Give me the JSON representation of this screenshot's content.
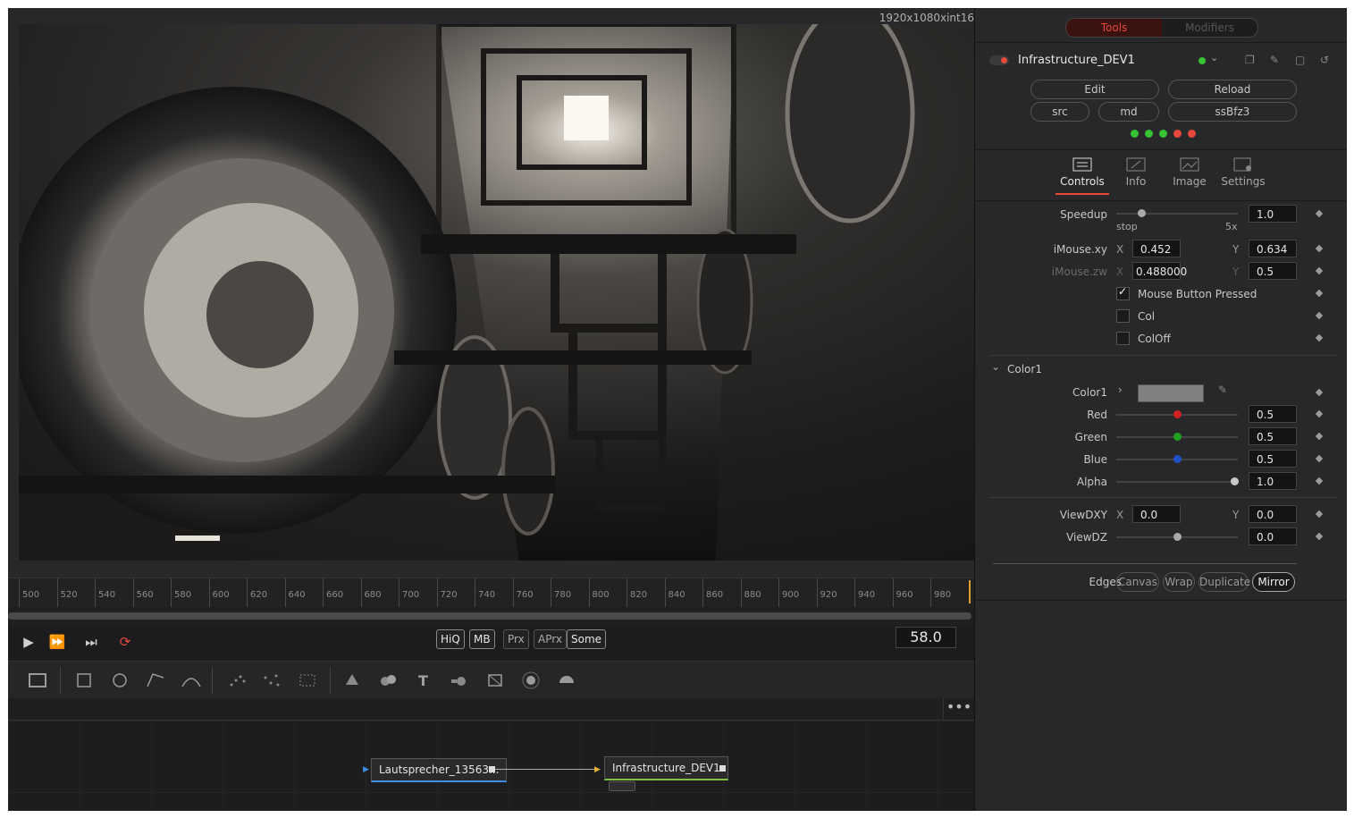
{
  "viewer": {
    "resolution": "1920x1080xint16"
  },
  "ruler": {
    "ticks": [
      "500",
      "520",
      "540",
      "560",
      "580",
      "600",
      "620",
      "640",
      "660",
      "680",
      "700",
      "720",
      "740",
      "760",
      "780",
      "800",
      "820",
      "840",
      "860",
      "880",
      "900",
      "920",
      "940",
      "960",
      "980"
    ]
  },
  "transport": {
    "modes": [
      "HiQ",
      "MB",
      "Prx",
      "APrx",
      "Some"
    ],
    "frame": "58.0"
  },
  "toolbar": {
    "icons": [
      "background-icon",
      "rectangle-icon",
      "ellipse-icon",
      "polygon-icon",
      "bspline-icon",
      "particle-emitter-icon",
      "particle-render-icon",
      "particle-grid-icon",
      "shape3d-icon",
      "merge3d-icon",
      "text3d-icon",
      "camera3d-icon",
      "renderer3d-icon",
      "light-icon",
      "spotlight-icon"
    ]
  },
  "nodes": {
    "source": "Lautsprecher_13563...",
    "target": "Infrastructure_DEV1"
  },
  "inspector": {
    "tabs": {
      "tools": "Tools",
      "modifiers": "Modifiers"
    },
    "node_name": "Infrastructure_DEV1",
    "buttons": {
      "edit": "Edit",
      "reload": "Reload",
      "src": "src",
      "md": "md",
      "shader": "ssBfz3"
    },
    "status_colors": [
      "#35c235",
      "#35c235",
      "#35c235",
      "#e8483a",
      "#e8483a"
    ],
    "panel_tabs": [
      "Controls",
      "Info",
      "Image",
      "Settings"
    ],
    "speedup": {
      "label": "Speedup",
      "value": "1.0",
      "min_label": "stop",
      "max_label": "5x",
      "fraction": 0.2
    },
    "imouse_xy": {
      "label": "iMouse.xy",
      "x_label": "X",
      "x": "0.452",
      "y_label": "Y",
      "y": "0.634"
    },
    "imouse_zw": {
      "label": "iMouse.zw",
      "x_label": "X",
      "x": "0.488000",
      "y_label": "Y",
      "y": "0.5"
    },
    "checks": [
      {
        "label": "Mouse Button Pressed",
        "checked": true
      },
      {
        "label": "Col",
        "checked": false
      },
      {
        "label": "ColOff",
        "checked": false
      }
    ],
    "color_group": "Color1",
    "color_label": "Color1",
    "swatch": "#808080",
    "channels": [
      {
        "label": "Red",
        "value": "0.5",
        "color": "#d02020",
        "fraction": 0.5
      },
      {
        "label": "Green",
        "value": "0.5",
        "color": "#20a020",
        "fraction": 0.5
      },
      {
        "label": "Blue",
        "value": "0.5",
        "color": "#2050c8",
        "fraction": 0.5
      },
      {
        "label": "Alpha",
        "value": "1.0",
        "color": "#c8c8c8",
        "fraction": 0.97
      }
    ],
    "viewdxy": {
      "label": "ViewDXY",
      "x_label": "X",
      "x": "0.0",
      "y_label": "Y",
      "y": "0.0"
    },
    "viewdz": {
      "label": "ViewDZ",
      "value": "0.0",
      "fraction": 0.5
    },
    "edges": {
      "label": "Edges",
      "options": [
        "Canvas",
        "Wrap",
        "Duplicate",
        "Mirror"
      ],
      "selected": "Mirror"
    }
  },
  "accent": "#e8483a"
}
